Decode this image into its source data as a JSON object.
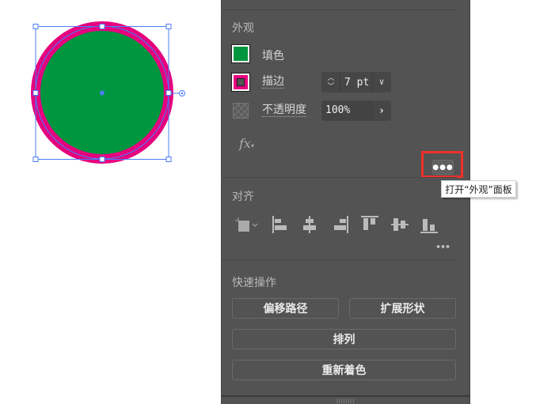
{
  "canvas": {
    "fill_color": "#009640",
    "stroke_color": "#e6007e",
    "selection_color": "#4a7cf6"
  },
  "appearance": {
    "title": "外观",
    "fill_label": "填色",
    "stroke_label": "描边",
    "stroke_weight": "7 pt",
    "opacity_label": "不透明度",
    "opacity_value": "100%",
    "fx_label": "fx",
    "more_tooltip": "打开“外观”面板"
  },
  "align": {
    "title": "对齐"
  },
  "quick_actions": {
    "title": "快速操作",
    "offset_path": "偏移路径",
    "expand_shape": "扩展形状",
    "arrange": "排列",
    "recolor": "重新着色"
  }
}
